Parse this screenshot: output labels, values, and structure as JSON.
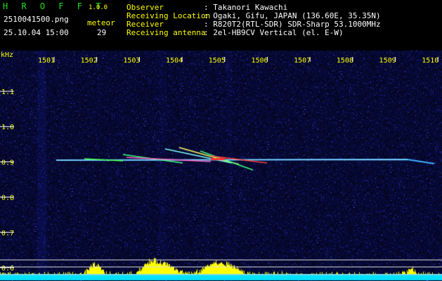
{
  "app": {
    "title": "H R O F F T",
    "version": "1.0.0",
    "filename": "2510041500.png",
    "datetime": "25.10.04 15:00",
    "meteor_label": "meteor",
    "meteor_count": "29"
  },
  "info": {
    "rows": [
      {
        "label": "Observer",
        "value": ": Takanori Kawachi"
      },
      {
        "label": "Receiving Location",
        "value": ": Ogaki, Gifu, JAPAN (136.60E, 35.35N)"
      },
      {
        "label": "Receiver",
        "value": ": R820T2(RTL-SDR) SDR-Sharp 53.1000MHz"
      },
      {
        "label": "Receiving antenna",
        "value": ": 2el-HB9CV Vertical (el. E-W)"
      }
    ]
  },
  "axes": {
    "y_unit": "kHz",
    "x_ticks": [
      "1501",
      "1502",
      "1503",
      "1504",
      "1505",
      "1506",
      "1507",
      "1508",
      "1509",
      "1510"
    ],
    "y_ticks": [
      "1.1",
      "1.0",
      "0.9",
      "0.8",
      "0.7",
      "0.6"
    ]
  },
  "colors": {
    "background": "#00001a",
    "header_label": "#ffff00",
    "axis_text": "#ffff00",
    "title_green": "#1fe01f",
    "level_fill": "#00e0ff",
    "level_peak": "#ffff00"
  }
}
